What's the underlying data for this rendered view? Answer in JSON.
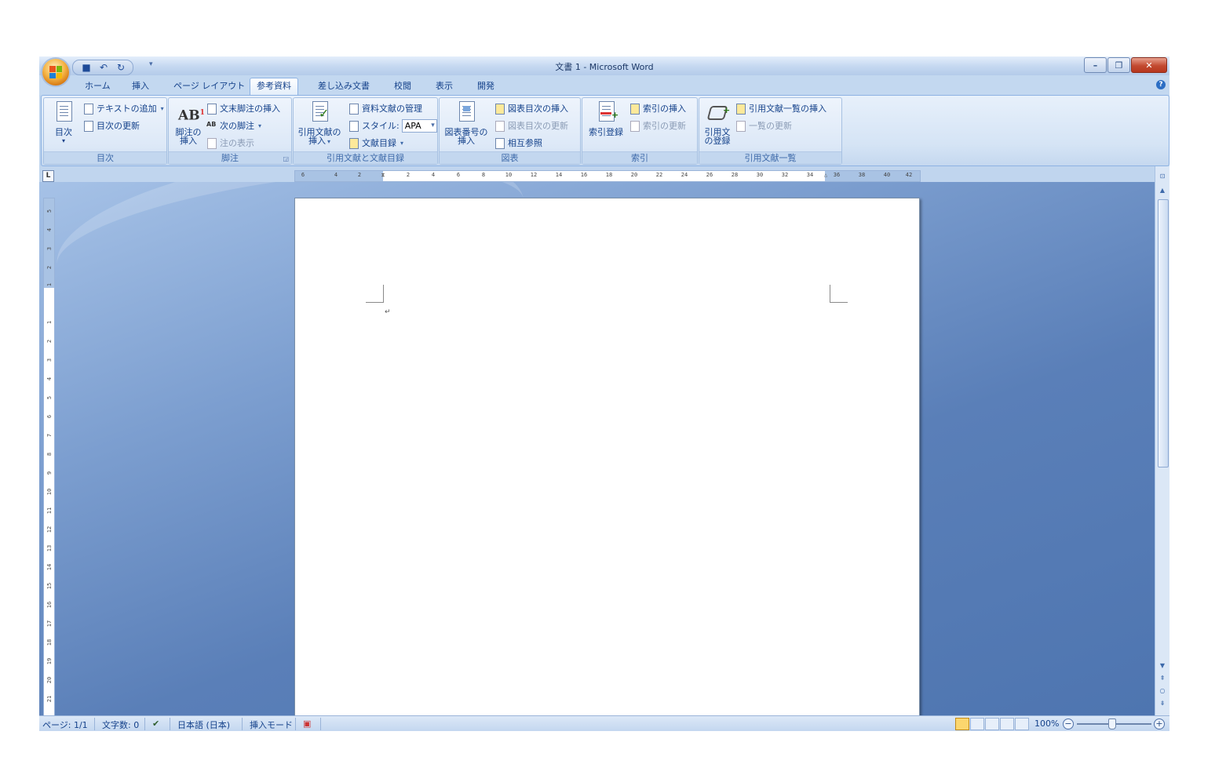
{
  "window": {
    "title": "文書 1 - Microsoft Word"
  },
  "qat": {
    "save_icon": "save-icon",
    "undo_icon": "undo-icon",
    "redo_icon": "redo-icon"
  },
  "tabs": [
    {
      "label": "ホーム"
    },
    {
      "label": "挿入"
    },
    {
      "label": "ページ レイアウト"
    },
    {
      "label": "参考資料",
      "active": true
    },
    {
      "label": "差し込み文書"
    },
    {
      "label": "校閲"
    },
    {
      "label": "表示"
    },
    {
      "label": "開発"
    }
  ],
  "ribbon": {
    "toc": {
      "group_label": "目次",
      "toc_button": "目次",
      "add_text": "テキストの追加",
      "update_toc": "目次の更新"
    },
    "footnotes": {
      "group_label": "脚注",
      "insert_footnote_1": "脚注の",
      "insert_footnote_2": "挿入",
      "insert_endnote": "文末脚注の挿入",
      "next_footnote": "次の脚注",
      "show_notes": "注の表示"
    },
    "citations": {
      "group_label": "引用文献と文献目録",
      "insert_citation_1": "引用文献の",
      "insert_citation_2": "挿入",
      "manage_sources": "資料文献の管理",
      "style_label": "スタイル:",
      "style_value": "APA",
      "bibliography": "文献目録"
    },
    "captions": {
      "group_label": "図表",
      "insert_caption_1": "図表番号の",
      "insert_caption_2": "挿入",
      "insert_table_of_figures": "図表目次の挿入",
      "update_table": "図表目次の更新",
      "cross_reference": "相互参照"
    },
    "index": {
      "group_label": "索引",
      "mark_entry": "索引登録",
      "insert_index": "索引の挿入",
      "update_index": "索引の更新"
    },
    "authorities": {
      "group_label": "引用文献一覧",
      "mark_citation_1": "引用文",
      "mark_citation_2": "の登録",
      "insert_toa": "引用文献一覧の挿入",
      "update_table": "一覧の更新"
    }
  },
  "ruler": {
    "h_ticks": [
      "6",
      "4",
      "2",
      "2",
      "4",
      "6",
      "8",
      "10",
      "12",
      "14",
      "16",
      "18",
      "20",
      "22",
      "24",
      "26",
      "28",
      "30",
      "32",
      "34",
      "36",
      "38",
      "40",
      "42"
    ],
    "v_ticks": [
      "5",
      "4",
      "3",
      "2",
      "1",
      "1",
      "2",
      "3",
      "4",
      "5",
      "6",
      "7",
      "8",
      "9",
      "10",
      "11",
      "12",
      "13",
      "14",
      "15",
      "16",
      "17",
      "18",
      "19",
      "20",
      "21"
    ]
  },
  "document": {
    "paragraph_mark": "↵"
  },
  "status": {
    "page": "ページ: 1/1",
    "word_count": "文字数: 0",
    "language": "日本語 (日本)",
    "insert_mode": "挿入モード",
    "zoom": "100%"
  }
}
